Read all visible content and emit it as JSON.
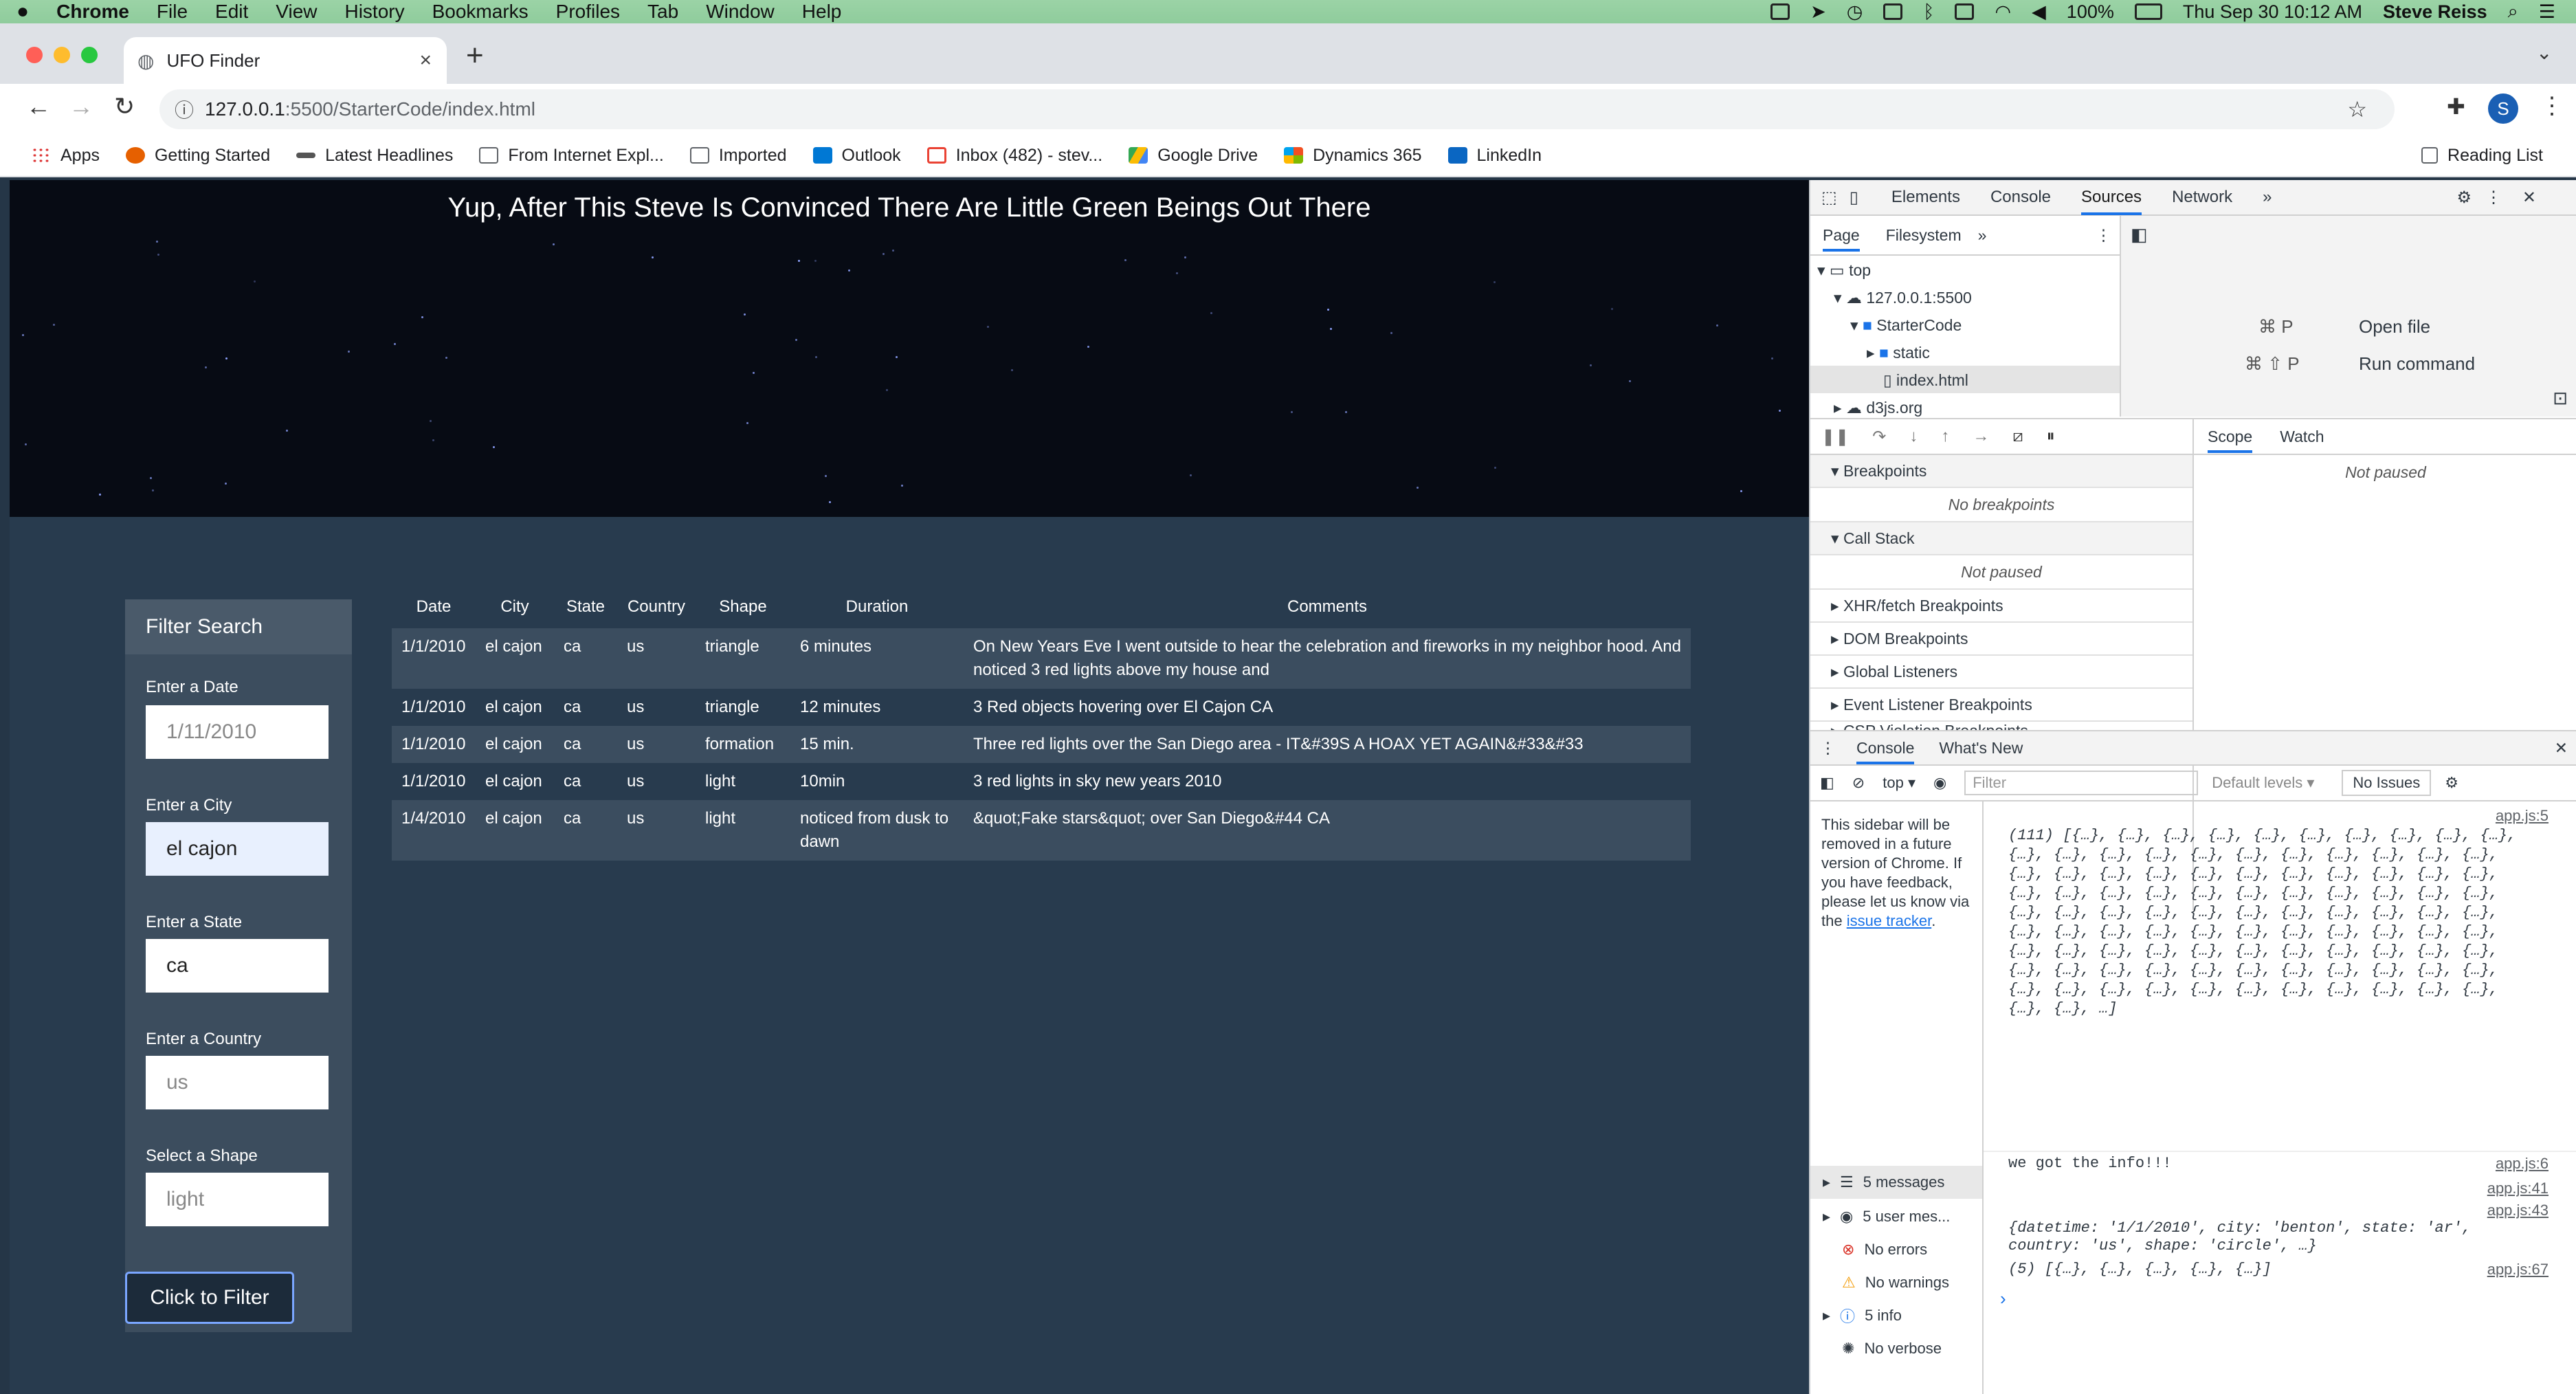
{
  "menubar": {
    "app": "Chrome",
    "items": [
      "File",
      "Edit",
      "View",
      "History",
      "Bookmarks",
      "Profiles",
      "Tab",
      "Window",
      "Help"
    ],
    "battery": "100%",
    "datetime": "Thu Sep 30  10:12 AM",
    "user": "Steve Reiss"
  },
  "browser": {
    "tab_title": "UFO Finder",
    "url_host": "127.0.0.1",
    "url_rest": ":5500/StarterCode/index.html",
    "profile_initial": "S",
    "bookmarks": [
      "Apps",
      "Getting Started",
      "Latest Headlines",
      "From Internet Expl...",
      "Imported",
      "Outlook",
      "Inbox (482) - stev...",
      "Google Drive",
      "Dynamics 365",
      "LinkedIn"
    ],
    "reading_list": "Reading List"
  },
  "page": {
    "title": "Yup, After This Steve Is Convinced There Are Little Green Beings Out There",
    "filter": {
      "heading": "Filter Search",
      "date_label": "Enter a Date",
      "date_placeholder": "1/11/2010",
      "city_label": "Enter a City",
      "city_value": "el cajon",
      "state_label": "Enter a State",
      "state_value": "ca",
      "country_label": "Enter a Country",
      "country_placeholder": "us",
      "shape_label": "Select a Shape",
      "shape_placeholder": "light",
      "button": "Click to Filter"
    },
    "table": {
      "headers": [
        "Date",
        "City",
        "State",
        "Country",
        "Shape",
        "Duration",
        "Comments"
      ],
      "rows": [
        [
          "1/1/2010",
          "el cajon",
          "ca",
          "us",
          "triangle",
          "6 minutes",
          "On New Years Eve I went outside to hear the celebration and fireworks in my neighbor hood. And noticed 3 red lights above my house and"
        ],
        [
          "1/1/2010",
          "el cajon",
          "ca",
          "us",
          "triangle",
          "12 minutes",
          "3 Red objects hovering over El Cajon CA"
        ],
        [
          "1/1/2010",
          "el cajon",
          "ca",
          "us",
          "formation",
          "15 min.",
          "Three red lights over the San Diego area - IT&#39S A HOAX YET AGAIN&#33&#33"
        ],
        [
          "1/1/2010",
          "el cajon",
          "ca",
          "us",
          "light",
          "10min",
          "3 red lights in sky new years 2010"
        ],
        [
          "1/4/2010",
          "el cajon",
          "ca",
          "us",
          "light",
          "noticed from dusk to dawn",
          "&quot;Fake stars&quot; over San Diego&#44 CA"
        ]
      ]
    }
  },
  "devtools": {
    "tabs": [
      "Elements",
      "Console",
      "Sources",
      "Network"
    ],
    "active_tab": "Sources",
    "nav_tabs": [
      "Page",
      "Filesystem"
    ],
    "tree": [
      "top",
      "127.0.0.1:5500",
      "StarterCode",
      "static",
      "index.html",
      "d3js.org"
    ],
    "shortcuts": [
      {
        "keys": "⌘ P",
        "label": "Open file"
      },
      {
        "keys": "⌘ ⇧ P",
        "label": "Run command"
      }
    ],
    "scope_tabs": [
      "Scope",
      "Watch"
    ],
    "not_paused": "Not paused",
    "sections": [
      "Breakpoints",
      "Call Stack",
      "XHR/fetch Breakpoints",
      "DOM Breakpoints",
      "Global Listeners",
      "Event Listener Breakpoints",
      "CSP Violation Breakpoints"
    ],
    "no_breakpoints": "No breakpoints",
    "console_tabs": [
      "Console",
      "What's New"
    ],
    "context": "top",
    "filter_placeholder": "Filter",
    "levels": "Default levels",
    "issues": "No Issues",
    "sidebar_note": "This sidebar will be removed in a future version of Chrome. If you have feedback, please let us know via the",
    "sidebar_link": "issue tracker",
    "sidebar_items": [
      "5 messages",
      "5 user mes...",
      "No errors",
      "No warnings",
      "5 info",
      "No verbose"
    ],
    "log": [
      {
        "src": "app.js:5",
        "text": "(111) [{…}, {…}, {…}, {…}, {…}, {…}, {…}, {…}, {…}, {…}, {…}, {…}, {…}, {…}, {…}, {…}, {…}, {…}, {…}, {…}, {…}, {…}, {…}, {…}, {…}, {…}, {…}, {…}, {…}, {…}, {…}, {…}, {…}, {…}, {…}, {…}, {…}, {…}, {…}, {…}, {…}, {…}, {…}, {…}, {…}, {…}, {…}, {…}, {…}, {…}, {…}, {…}, {…}, {…}, {…}, {…}, {…}, {…}, {…}, {…}, {…}, {…}, {…}, {…}, {…}, {…}, {…}, {…}, {…}, {…}, {…}, {…}, {…}, {…}, {…}, {…}, {…}, {…}, {…}, {…}, {…}, {…}, {…}, {…}, {…}, {…}, {…}, {…}, {…}, {…}, {…}, {…}, {…}, {…}, {…}, {…}, {…}, {…}, {…}, {…}, …]"
      },
      {
        "src": "app.js:6",
        "text": "we got the info!!!"
      },
      {
        "src": "app.js:41",
        "text": ""
      },
      {
        "src": "app.js:43",
        "text": "{datetime: '1/1/2010', city: 'benton', state: 'ar', country: 'us', shape: 'circle', …}"
      },
      {
        "src": "app.js:67",
        "text": "(5) [{…}, {…}, {…}, {…}, {…}]"
      }
    ]
  }
}
